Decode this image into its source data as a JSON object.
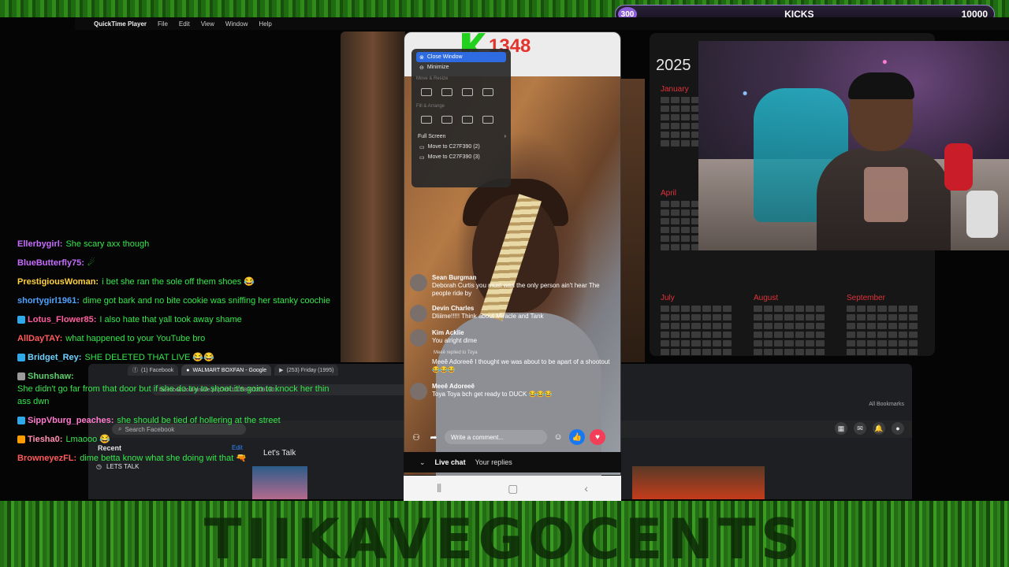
{
  "kicks": {
    "start": "300",
    "label": "KICKS",
    "goal": "10000"
  },
  "menubar": {
    "apple": "",
    "app": "QuickTime Player",
    "items": [
      "File",
      "Edit",
      "View",
      "Window",
      "Help"
    ]
  },
  "counter": {
    "letter": "K",
    "value": "1348"
  },
  "window_menu": {
    "close": "Close Window",
    "minimize": "Minimize",
    "section_move": "Move & Resize",
    "section_fill": "Fill & Arrange",
    "full_screen": "Full Screen",
    "move1": "Move to C27F390 (2)",
    "move2": "Move to C27F390 (3)"
  },
  "calendar": {
    "year": "2025",
    "months": [
      "January",
      "April",
      "July",
      "August",
      "September"
    ]
  },
  "chat": [
    {
      "user": "Ellerbygirl:",
      "text": "She scary axx though",
      "color": "#c86cff",
      "badge": ""
    },
    {
      "user": "BlueButterfly75:",
      "text": "☄",
      "color": "#c86cff",
      "badge": ""
    },
    {
      "user": "PrestigiousWoman:",
      "text": "i bet she ran the sole off them shoes 😂",
      "color": "#ffd23a",
      "badge": ""
    },
    {
      "user": "shortygirl1961:",
      "text": "dime got bark and no bite cookie was sniffing her stanky coochie",
      "color": "#4fa3ff",
      "badge": ""
    },
    {
      "user": "Lotus_Flower85:",
      "text": "I also hate that yall took away shame",
      "color": "#ff5fa0",
      "badge": "#31a8e8"
    },
    {
      "user": "AllDayTAY:",
      "text": "what happened to your YouTube bro",
      "color": "#ff5b5b",
      "badge": ""
    },
    {
      "user": "Bridget_Rey:",
      "text": "SHE DELETED THAT LIVE 😂😂",
      "color": "#6fd0ff",
      "badge": "#31a8e8"
    },
    {
      "user": "Shunshaw:",
      "text": "She didn't go far from that door but if she do try to shoot it's goin to knock her thin ass dwn",
      "color": "#5dd06b",
      "badge": "#9a9a9a"
    },
    {
      "user": "SippVburg_peaches:",
      "text": "she should be tied of hollering at the street",
      "color": "#ff7ad0",
      "badge": "#31a8e8"
    },
    {
      "user": "Tiesha0:",
      "text": "Lmaooo 😂",
      "color": "#ff8fb0",
      "badge": "#ff9d00"
    },
    {
      "user": "BrowneyezFL:",
      "text": "dime betta know what she doing wit that 🔫",
      "color": "#ff5b5b",
      "badge": ""
    }
  ],
  "browser": {
    "tabs": [
      "(1) Facebook",
      "WALMART BOXFAN - Google",
      "(253) Friday (1995)"
    ],
    "url": "facebook.com/profile.php?id=100089312091901",
    "bookmarks": "All Bookmarks",
    "search_placeholder": "Search Facebook",
    "recent": "Recent",
    "edit": "Edit",
    "lets_talk": "Let's Talk",
    "recent_item": "LETS TALK"
  },
  "live": {
    "comments": [
      {
        "name": "Sean Burgman",
        "text": "Deborah Curtis you must was the only person ain't hear The people ride by"
      },
      {
        "name": "Devin Charles",
        "text": "Dliiime!!!!! Think about Miracle and Tank"
      },
      {
        "name": "Kim Acklie",
        "text": "You alright dime"
      },
      {
        "name": "Meeê Adoreeê",
        "text": "Meeê Adoreeê I thought we was about to be apart of a shootout 😂😂😂"
      },
      {
        "name": "Meeê Adoreeê",
        "text": "Toya Toya bch get ready to DUCK 😂😂😂"
      }
    ],
    "reply_note": "Meeê replied to Toya",
    "composer_placeholder": "Write a comment...",
    "tab_live": "Live chat",
    "tab_replies": "Your replies"
  },
  "banner": "TIIKAVEGOCENTS",
  "colors": {
    "accent_green": "#22d11d",
    "counter_red": "#e2332c",
    "fb_blue": "#1877f2",
    "cal_red": "#e0333a"
  }
}
